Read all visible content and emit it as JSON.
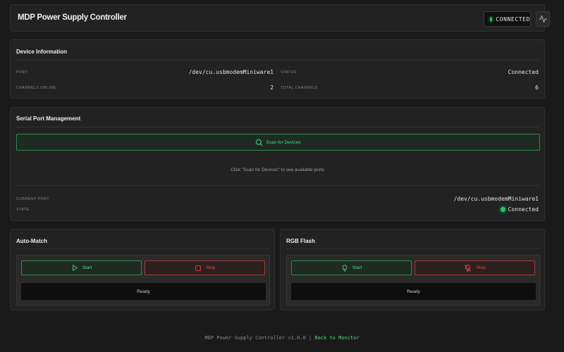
{
  "header": {
    "title": "MDP Power Supply Controller",
    "connection_label": "CONNECTED",
    "monitor_icon": "activity-icon"
  },
  "device_info": {
    "title": "Device Information",
    "port_label": "PORT",
    "port_value": "/dev/cu.usbmodemMiniware1",
    "status_label": "STATUS",
    "status_value": "Connected",
    "channels_online_label": "CHANNELS ONLINE",
    "channels_online_value": "2",
    "total_channels_label": "TOTAL CHANNELS",
    "total_channels_value": "6"
  },
  "serial_port": {
    "title": "Serial Port Management",
    "scan_button": "Scan for Devices",
    "hint": "Click \"Scan for Devices\" to see available ports",
    "current_port_label": "CURRENT PORT",
    "current_port_value": "/dev/cu.usbmodemMiniware1",
    "state_label": "STATE",
    "state_value": "Connected"
  },
  "auto_match": {
    "title": "Auto-Match",
    "start_label": "Start",
    "stop_label": "Stop",
    "status": "Ready"
  },
  "rgb_flash": {
    "title": "RGB Flash",
    "start_label": "Start",
    "stop_label": "Stop",
    "status": "Ready"
  },
  "footer": {
    "text": "MDP Power Supply Controller v1.0.0 | ",
    "link": "Back to Monitor"
  },
  "colors": {
    "background": "#1a1a1a",
    "panel": "#222222",
    "accent_green": "#4ade80",
    "accent_red": "#ef4444"
  }
}
